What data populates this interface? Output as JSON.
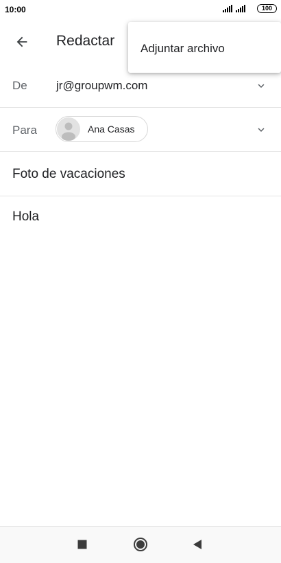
{
  "status_bar": {
    "time": "10:00",
    "battery": "100",
    "icons": [
      "signal-icon",
      "signal-icon",
      "battery-icon"
    ]
  },
  "app_bar": {
    "title": "Redactar",
    "back_icon": "arrow-back-icon"
  },
  "from": {
    "label": "De",
    "value": "jr@groupwm.com",
    "icon": "chevron-down-icon"
  },
  "to": {
    "label": "Para",
    "recipients": [
      {
        "name": "Ana Casas",
        "icon": "avatar-icon"
      }
    ],
    "icon": "chevron-down-icon"
  },
  "subject": {
    "value": "Foto de vacaciones"
  },
  "body": {
    "value": "Hola"
  },
  "overflow_menu": {
    "items": [
      {
        "label": "Adjuntar archivo"
      }
    ]
  },
  "nav_bar": {
    "icons": [
      "recent-apps-icon",
      "home-icon",
      "back-icon"
    ]
  }
}
